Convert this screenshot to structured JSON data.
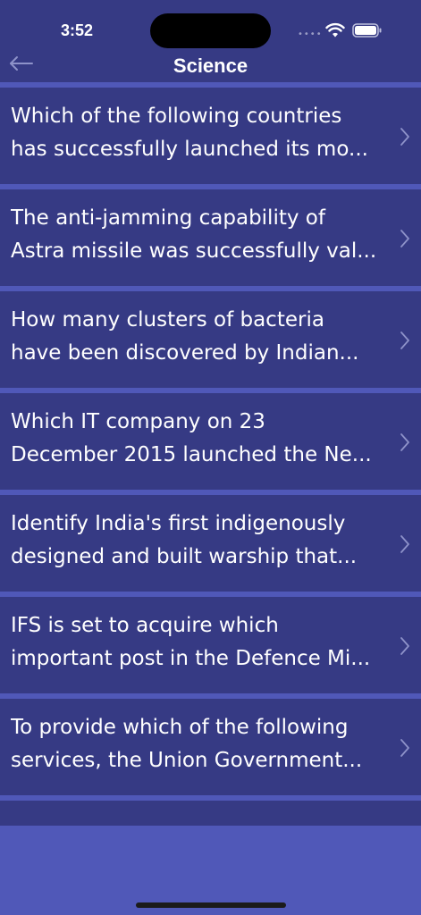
{
  "status": {
    "time": "3:52"
  },
  "nav": {
    "title": "Science",
    "back_icon": "arrow-left-icon"
  },
  "questions": [
    {
      "line1": "Which of the following countries",
      "line2": "has successfully launched its mo..."
    },
    {
      "line1": "The anti-jamming capability of",
      "line2": "Astra missile was successfully val..."
    },
    {
      "line1": "How many clusters of bacteria",
      "line2": "have been discovered by Indian..."
    },
    {
      "line1": "Which IT company on 23",
      "line2": "December 2015 launched the Ne..."
    },
    {
      "line1": "Identify India's first indigenously",
      "line2": "designed and built warship that..."
    },
    {
      "line1": "IFS is set to acquire which",
      "line2": "important post in the Defence Mi..."
    },
    {
      "line1": "To provide which of the following",
      "line2": "services, the Union Government..."
    }
  ],
  "colors": {
    "background": "#363A84",
    "separator": "#5058B8",
    "text": "#FFFFFF"
  }
}
